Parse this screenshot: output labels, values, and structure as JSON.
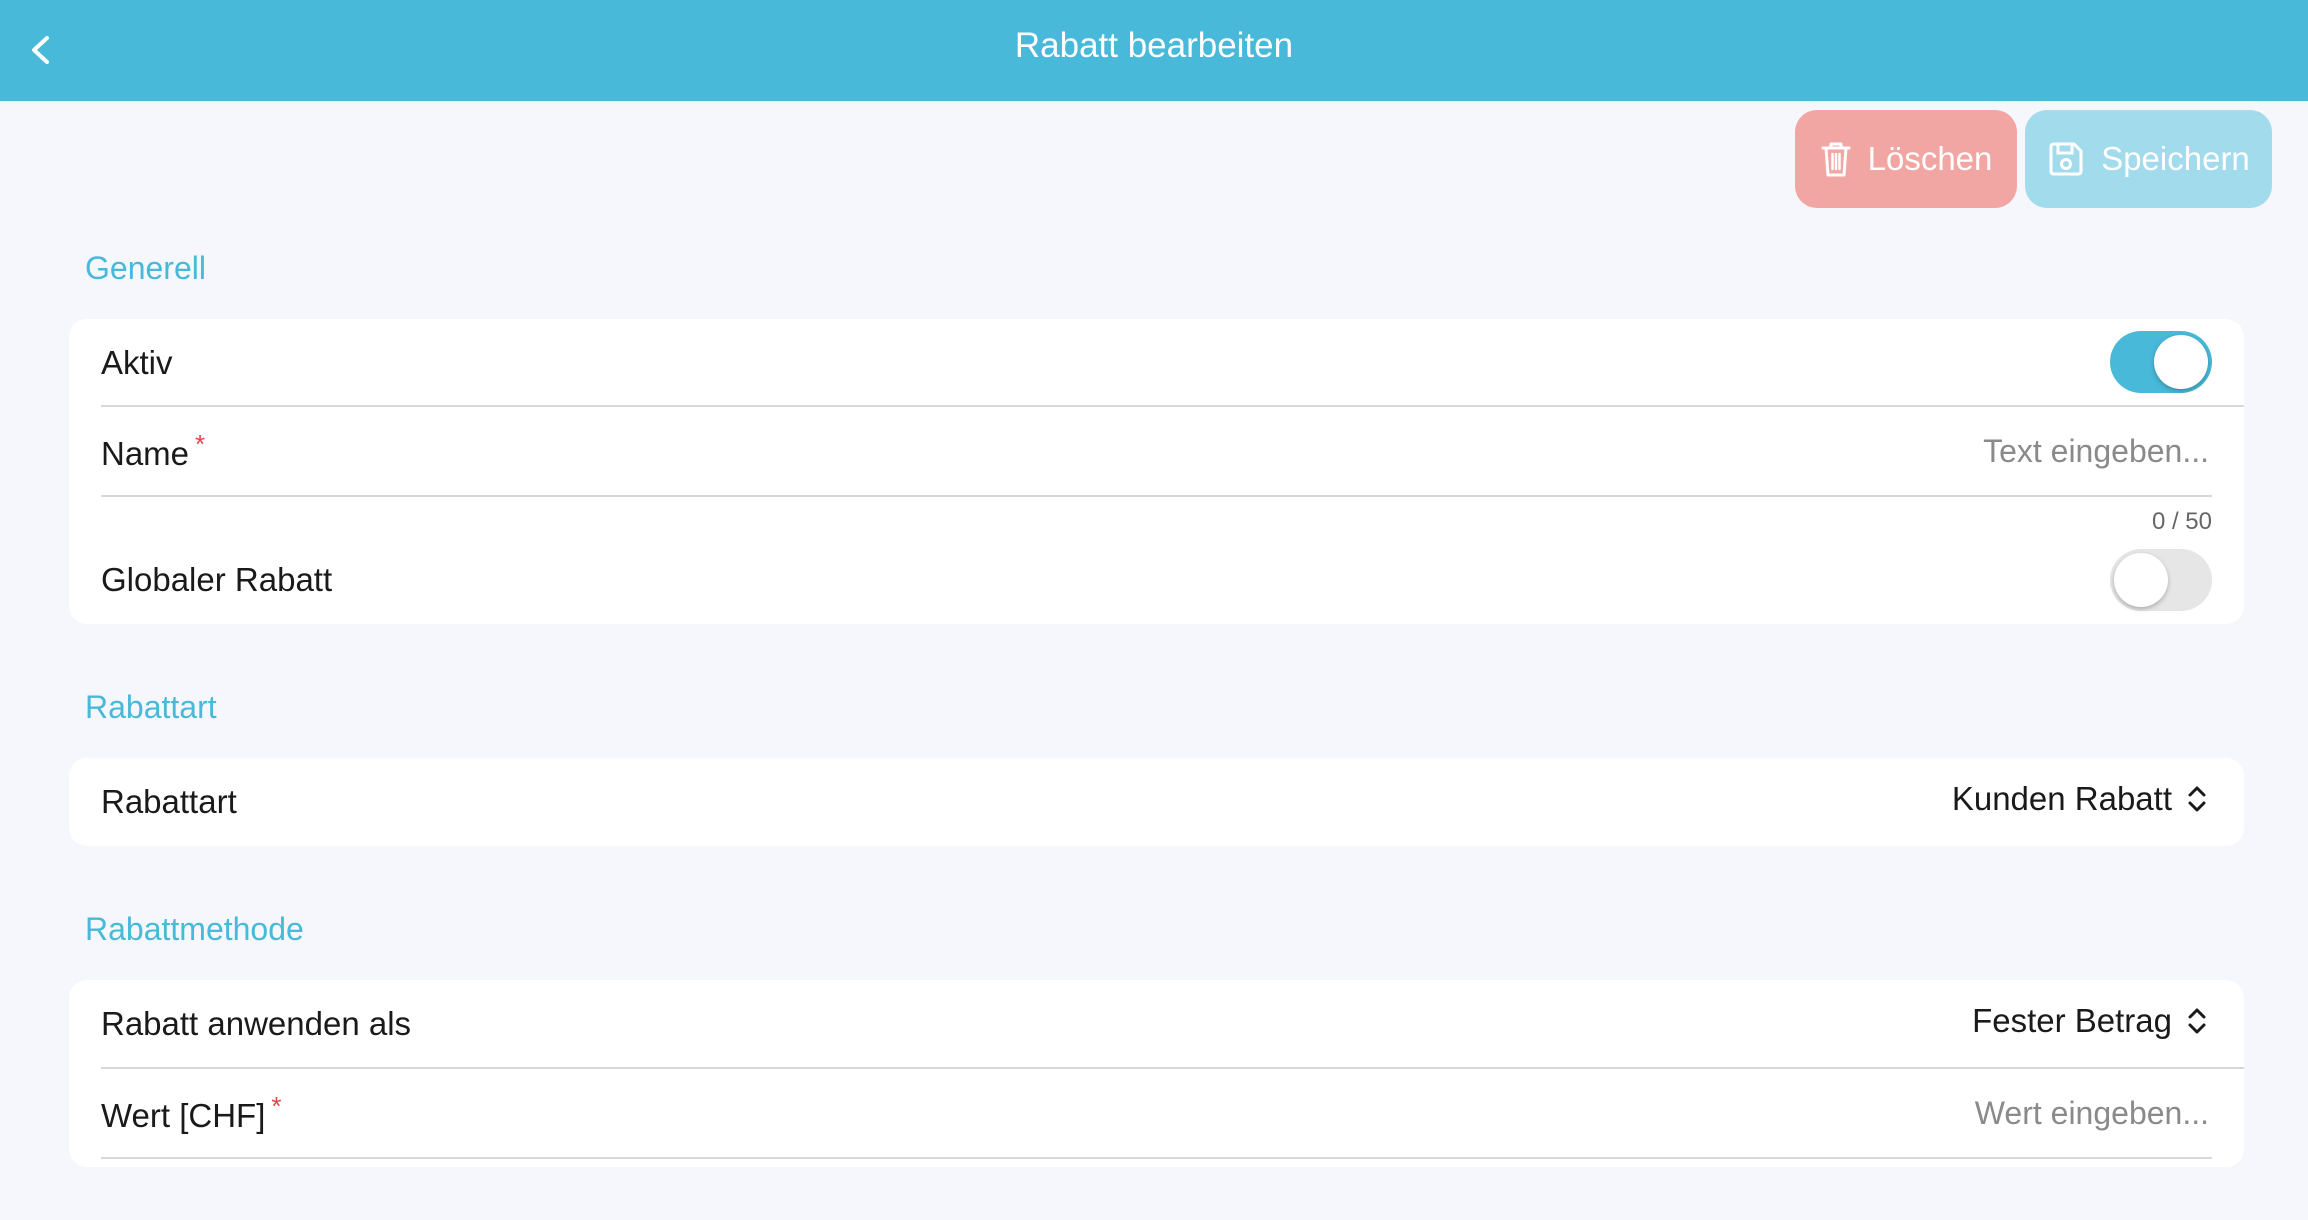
{
  "header": {
    "title": "Rabatt bearbeiten",
    "back_icon": "chevron-left-icon"
  },
  "actions": {
    "delete_label": "Löschen",
    "delete_icon": "trash-icon",
    "save_label": "Speichern",
    "save_icon": "floppy-disk-icon"
  },
  "sections": {
    "general": {
      "title": "Generell",
      "active_label": "Aktiv",
      "active_on": true,
      "name_label": "Name",
      "name_required": "*",
      "name_value": "",
      "name_placeholder": "Text eingeben...",
      "name_counter": "0 / 50",
      "global_label": "Globaler Rabatt",
      "global_on": false
    },
    "type": {
      "title": "Rabattart",
      "type_label": "Rabattart",
      "type_value": "Kunden Rabatt"
    },
    "method": {
      "title": "Rabattmethode",
      "apply_label": "Rabatt anwenden als",
      "apply_value": "Fester Betrag",
      "value_label": "Wert [CHF]",
      "value_required": "*",
      "value_placeholder": "Wert eingeben..."
    }
  },
  "colors": {
    "accent": "#48b9d8",
    "delete": "#f2a6a4",
    "save": "#a2dcec",
    "required": "#e0454c"
  }
}
